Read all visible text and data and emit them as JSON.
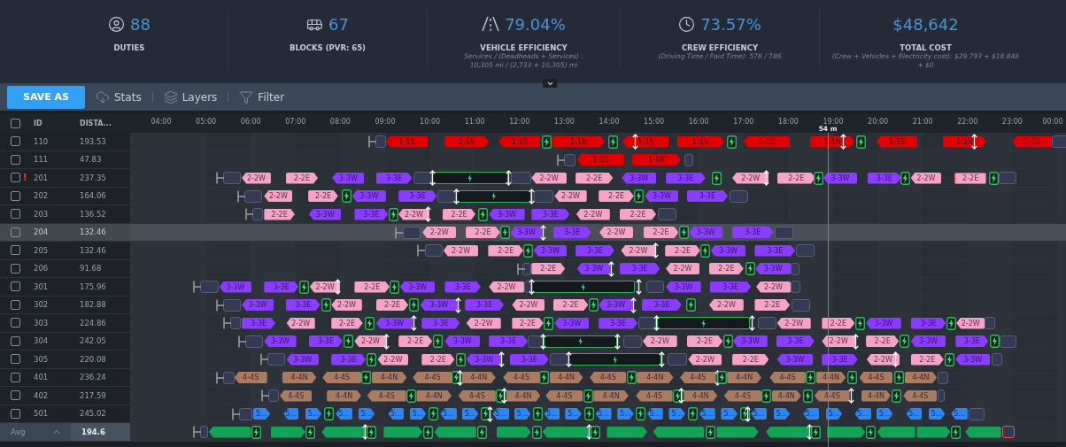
{
  "stats": [
    {
      "kind": "duties",
      "value": "88",
      "label": "DUTIES"
    },
    {
      "kind": "blocks",
      "value": "67",
      "label": "BLOCKS (PVR: 65)"
    },
    {
      "kind": "vehicle",
      "value": "79.04%",
      "label": "VEHICLE EFFICIENCY",
      "note": [
        "Services / (Deadheads + Services) :",
        "10,305 mi / (2,733 + 10,305) mi"
      ]
    },
    {
      "kind": "crew",
      "value": "73.57%",
      "label": "CREW EFFICIENCY",
      "note": [
        "(Driving Time / Paid Time): 578 / 786"
      ]
    },
    {
      "kind": "cost",
      "value": "$48,642",
      "label": "TOTAL COST",
      "note": [
        "(Crew + Vehicles + Electricity cost): $29.793 + $18.848",
        "+ $0"
      ]
    }
  ],
  "details_toggle": {
    "expanded": true
  },
  "toolbar": {
    "save_button": "SAVE AS",
    "tools": [
      {
        "kind": "stats",
        "label": "Stats"
      },
      {
        "kind": "layers",
        "label": "Layers"
      },
      {
        "kind": "filter",
        "label": "Filter"
      }
    ]
  },
  "columns": {
    "all_checked": false,
    "id": "ID",
    "distance": "DISTA..."
  },
  "hours": [
    "04:00",
    "05:00",
    "06:00",
    "07:00",
    "08:00",
    "09:00",
    "10:00",
    "11:00",
    "12:00",
    "13:00",
    "14:00",
    "15:00",
    "16:00",
    "17:00",
    "18:00",
    "19:00",
    "20:00",
    "21:00",
    "22:00",
    "23:00",
    "00:00"
  ],
  "cursor": {
    "label": "54 m"
  },
  "rows": [
    {
      "id": "110",
      "distance": "193.53",
      "checked": false,
      "selected": false,
      "items": [
        {
          "kind": "pullout"
        },
        {
          "kind": "depot"
        },
        {
          "kind": "trip",
          "label": "1-1S",
          "points_left": true,
          "color": "#e00000"
        },
        {
          "kind": "trip",
          "label": "1-1N",
          "points_left": false,
          "color": "#e00000"
        },
        {
          "kind": "trip",
          "label": "1-1S",
          "points_left": true,
          "color": "#e00000"
        },
        {
          "kind": "charge"
        },
        {
          "kind": "trip",
          "label": "1-1N",
          "points_left": false,
          "color": "#e00000"
        },
        {
          "kind": "charge"
        },
        {
          "kind": "trip",
          "label": "1-1S",
          "points_left": true,
          "color": "#e00000"
        },
        {
          "kind": "relief"
        },
        {
          "kind": "trip",
          "label": "1-1N",
          "points_left": false,
          "color": "#e00000"
        },
        {
          "kind": "charge"
        },
        {
          "kind": "trip",
          "label": "1-1S",
          "points_left": true,
          "color": "#e00000"
        },
        {
          "kind": "trip",
          "label": "1-1N",
          "points_left": false,
          "color": "#e00000"
        },
        {
          "kind": "relief"
        },
        {
          "kind": "charge"
        },
        {
          "kind": "trip",
          "label": "1-1S",
          "points_left": true,
          "color": "#e00000"
        },
        {
          "kind": "trip",
          "label": "1-1N",
          "points_left": false,
          "color": "#e00000"
        },
        {
          "kind": "relief"
        },
        {
          "kind": "trip",
          "label": "1-1S",
          "points_left": true,
          "color": "#e00000"
        },
        {
          "kind": "depot"
        }
      ]
    },
    {
      "id": "111",
      "distance": "47.83",
      "checked": false,
      "selected": false,
      "items": [
        {
          "kind": "pullout"
        },
        {
          "kind": "depot"
        },
        {
          "kind": "trip",
          "label": "1-1S",
          "points_left": true,
          "color": "#e00000"
        },
        {
          "kind": "trip",
          "label": "1-1N",
          "points_left": false,
          "color": "#e00000"
        },
        {
          "kind": "depot"
        }
      ]
    },
    {
      "id": "201",
      "distance": "237.35",
      "checked": false,
      "selected": false,
      "warning_mark": "!",
      "items": [
        {
          "kind": "pullout"
        },
        {
          "kind": "depot"
        },
        {
          "kind": "trip",
          "label": "2-2W",
          "points_left": true,
          "color": "#f5a3c7"
        },
        {
          "kind": "trip",
          "label": "2-2E",
          "points_left": false,
          "color": "#f5a3c7"
        },
        {
          "kind": "trip",
          "label": "3-3W",
          "points_left": true,
          "color": "#8b3dff"
        },
        {
          "kind": "trip",
          "label": "3-3E",
          "points_left": false,
          "color": "#8b3dff"
        },
        {
          "kind": "depot"
        },
        {
          "kind": "charging"
        },
        {
          "kind": "relief"
        },
        {
          "kind": "relief"
        },
        {
          "kind": "depot"
        },
        {
          "kind": "trip",
          "label": "2-2W",
          "points_left": true,
          "color": "#f5a3c7"
        },
        {
          "kind": "trip",
          "label": "2-2E",
          "points_left": false,
          "color": "#f5a3c7"
        },
        {
          "kind": "trip",
          "label": "3-3W",
          "points_left": true,
          "color": "#8b3dff"
        },
        {
          "kind": "trip",
          "label": "3-3E",
          "points_left": false,
          "color": "#8b3dff"
        },
        {
          "kind": "charge"
        },
        {
          "kind": "trip",
          "label": "2-2W",
          "points_left": true,
          "color": "#f5a3c7"
        },
        {
          "kind": "relief"
        },
        {
          "kind": "trip",
          "label": "2-2E",
          "points_left": false,
          "color": "#f5a3c7"
        },
        {
          "kind": "charge"
        },
        {
          "kind": "trip",
          "label": "3-3W",
          "points_left": true,
          "color": "#8b3dff"
        },
        {
          "kind": "trip",
          "label": "3-3E",
          "points_left": false,
          "color": "#8b3dff"
        },
        {
          "kind": "charge"
        },
        {
          "kind": "trip",
          "label": "2-2W",
          "points_left": true,
          "color": "#f5a3c7"
        },
        {
          "kind": "trip",
          "label": "2-2E",
          "points_left": false,
          "color": "#f5a3c7",
          "alert": true
        },
        {
          "kind": "charge"
        },
        {
          "kind": "depot"
        }
      ]
    },
    {
      "id": "202",
      "distance": "164.06",
      "checked": false,
      "selected": false,
      "items": [
        {
          "kind": "pullout"
        },
        {
          "kind": "depot"
        },
        {
          "kind": "trip",
          "label": "2-2W",
          "points_left": true,
          "color": "#f5a3c7"
        },
        {
          "kind": "trip",
          "label": "2-2E",
          "points_left": false,
          "color": "#f5a3c7"
        },
        {
          "kind": "charge"
        },
        {
          "kind": "trip",
          "label": "3-3W",
          "points_left": true,
          "color": "#8b3dff"
        },
        {
          "kind": "trip",
          "label": "3-3E",
          "points_left": false,
          "color": "#8b3dff"
        },
        {
          "kind": "depot"
        },
        {
          "kind": "charging"
        },
        {
          "kind": "relief"
        },
        {
          "kind": "relief"
        },
        {
          "kind": "depot"
        },
        {
          "kind": "trip",
          "label": "2-2W",
          "points_left": true,
          "color": "#f5a3c7"
        },
        {
          "kind": "trip",
          "label": "2-2E",
          "points_left": false,
          "color": "#f5a3c7"
        },
        {
          "kind": "charge"
        },
        {
          "kind": "trip",
          "label": "3-3W",
          "points_left": true,
          "color": "#8b3dff"
        },
        {
          "kind": "trip",
          "label": "3-3E",
          "points_left": false,
          "color": "#8b3dff"
        },
        {
          "kind": "depot"
        }
      ]
    },
    {
      "id": "203",
      "distance": "136.52",
      "checked": false,
      "selected": false,
      "items": [
        {
          "kind": "pullout"
        },
        {
          "kind": "depot"
        },
        {
          "kind": "trip",
          "label": "2-2E",
          "points_left": false,
          "color": "#f5a3c7"
        },
        {
          "kind": "trip",
          "label": "3-3W",
          "points_left": true,
          "color": "#8b3dff"
        },
        {
          "kind": "trip",
          "label": "3-3E",
          "points_left": false,
          "color": "#8b3dff"
        },
        {
          "kind": "charge"
        },
        {
          "kind": "trip",
          "label": "2-2W",
          "points_left": true,
          "color": "#f5a3c7"
        },
        {
          "kind": "relief"
        },
        {
          "kind": "trip",
          "label": "2-2E",
          "points_left": false,
          "color": "#f5a3c7"
        },
        {
          "kind": "charge"
        },
        {
          "kind": "trip",
          "label": "3-3W",
          "points_left": true,
          "color": "#8b3dff"
        },
        {
          "kind": "trip",
          "label": "3-3E",
          "points_left": false,
          "color": "#8b3dff"
        },
        {
          "kind": "trip",
          "label": "2-2W",
          "points_left": true,
          "color": "#f5a3c7"
        },
        {
          "kind": "trip",
          "label": "2-2E",
          "points_left": false,
          "color": "#f5a3c7"
        },
        {
          "kind": "depot"
        }
      ]
    },
    {
      "id": "204",
      "distance": "132.46",
      "checked": false,
      "selected": true,
      "items": [
        {
          "kind": "pullout"
        },
        {
          "kind": "depot"
        },
        {
          "kind": "trip",
          "label": "2-2W",
          "points_left": true,
          "color": "#f5a3c7"
        },
        {
          "kind": "trip",
          "label": "2-2E",
          "points_left": false,
          "color": "#f5a3c7"
        },
        {
          "kind": "charge"
        },
        {
          "kind": "trip",
          "label": "3-3W",
          "points_left": true,
          "color": "#8b3dff"
        },
        {
          "kind": "relief"
        },
        {
          "kind": "trip",
          "label": "3-3E",
          "points_left": false,
          "color": "#8b3dff"
        },
        {
          "kind": "trip",
          "label": "2-2W",
          "points_left": true,
          "color": "#f5a3c7"
        },
        {
          "kind": "trip",
          "label": "2-2E",
          "points_left": false,
          "color": "#f5a3c7"
        },
        {
          "kind": "charge"
        },
        {
          "kind": "trip",
          "label": "3-3W",
          "points_left": true,
          "color": "#8b3dff"
        },
        {
          "kind": "trip",
          "label": "3-3E",
          "points_left": false,
          "color": "#8b3dff"
        },
        {
          "kind": "depot"
        }
      ]
    },
    {
      "id": "205",
      "distance": "132.46",
      "checked": false,
      "selected": false,
      "items": [
        {
          "kind": "pullout"
        },
        {
          "kind": "depot"
        },
        {
          "kind": "trip",
          "label": "2-2W",
          "points_left": true,
          "color": "#f5a3c7"
        },
        {
          "kind": "trip",
          "label": "2-2E",
          "points_left": false,
          "color": "#f5a3c7"
        },
        {
          "kind": "charge"
        },
        {
          "kind": "trip",
          "label": "3-3W",
          "points_left": true,
          "color": "#8b3dff"
        },
        {
          "kind": "trip",
          "label": "3-3E",
          "points_left": false,
          "color": "#8b3dff"
        },
        {
          "kind": "trip",
          "label": "2-2W",
          "points_left": true,
          "color": "#f5a3c7"
        },
        {
          "kind": "relief"
        },
        {
          "kind": "trip",
          "label": "2-2E",
          "points_left": false,
          "color": "#f5a3c7"
        },
        {
          "kind": "charge"
        },
        {
          "kind": "trip",
          "label": "3-3W",
          "points_left": true,
          "color": "#8b3dff"
        },
        {
          "kind": "trip",
          "label": "3-3E",
          "points_left": false,
          "color": "#8b3dff"
        },
        {
          "kind": "depot"
        }
      ]
    },
    {
      "id": "206",
      "distance": "91.68",
      "checked": false,
      "selected": false,
      "items": [
        {
          "kind": "pullout"
        },
        {
          "kind": "depot"
        },
        {
          "kind": "trip",
          "label": "2-2E",
          "points_left": false,
          "color": "#f5a3c7"
        },
        {
          "kind": "trip",
          "label": "3-3W",
          "points_left": true,
          "color": "#8b3dff"
        },
        {
          "kind": "relief"
        },
        {
          "kind": "trip",
          "label": "3-3E",
          "points_left": false,
          "color": "#8b3dff"
        },
        {
          "kind": "trip",
          "label": "2-2W",
          "points_left": true,
          "color": "#f5a3c7"
        },
        {
          "kind": "trip",
          "label": "2-2E",
          "points_left": false,
          "color": "#f5a3c7"
        },
        {
          "kind": "charge"
        },
        {
          "kind": "trip",
          "label": "3-3W",
          "points_left": true,
          "color": "#8b3dff"
        },
        {
          "kind": "depot"
        }
      ]
    },
    {
      "id": "301",
      "distance": "175.96",
      "checked": false,
      "selected": false,
      "items": [
        {
          "kind": "pullout"
        },
        {
          "kind": "depot"
        },
        {
          "kind": "trip",
          "label": "3-3W",
          "points_left": true,
          "color": "#8b3dff"
        },
        {
          "kind": "trip",
          "label": "3-3E",
          "points_left": false,
          "color": "#8b3dff"
        },
        {
          "kind": "charge"
        },
        {
          "kind": "trip",
          "label": "2-2W",
          "points_left": true,
          "color": "#f5a3c7"
        },
        {
          "kind": "relief"
        },
        {
          "kind": "trip",
          "label": "2-2E",
          "points_left": false,
          "color": "#f5a3c7"
        },
        {
          "kind": "charge"
        },
        {
          "kind": "trip",
          "label": "3-3W",
          "points_left": true,
          "color": "#8b3dff"
        },
        {
          "kind": "trip",
          "label": "3-3E",
          "points_left": false,
          "color": "#8b3dff"
        },
        {
          "kind": "trip",
          "label": "2-2W",
          "points_left": true,
          "color": "#f5a3c7"
        },
        {
          "kind": "depot"
        },
        {
          "kind": "charging"
        },
        {
          "kind": "relief"
        },
        {
          "kind": "relief"
        },
        {
          "kind": "depot"
        },
        {
          "kind": "trip",
          "label": "3-3W",
          "points_left": true,
          "color": "#8b3dff"
        },
        {
          "kind": "trip",
          "label": "3-3E",
          "points_left": false,
          "color": "#8b3dff"
        },
        {
          "kind": "trip",
          "label": "2-2W",
          "points_left": true,
          "color": "#f5a3c7"
        },
        {
          "kind": "depot"
        }
      ]
    },
    {
      "id": "302",
      "distance": "182.88",
      "checked": false,
      "selected": false,
      "items": [
        {
          "kind": "pullout"
        },
        {
          "kind": "depot"
        },
        {
          "kind": "trip",
          "label": "3-3W",
          "points_left": true,
          "color": "#8b3dff"
        },
        {
          "kind": "trip",
          "label": "3-3E",
          "points_left": false,
          "color": "#8b3dff"
        },
        {
          "kind": "charge"
        },
        {
          "kind": "trip",
          "label": "2-2W",
          "points_left": true,
          "color": "#f5a3c7"
        },
        {
          "kind": "trip",
          "label": "2-2E",
          "points_left": false,
          "color": "#f5a3c7"
        },
        {
          "kind": "charge"
        },
        {
          "kind": "trip",
          "label": "3-3W",
          "points_left": true,
          "color": "#8b3dff"
        },
        {
          "kind": "relief"
        },
        {
          "kind": "trip",
          "label": "3-3E",
          "points_left": false,
          "color": "#8b3dff"
        },
        {
          "kind": "trip",
          "label": "2-2W",
          "points_left": true,
          "color": "#f5a3c7"
        },
        {
          "kind": "trip",
          "label": "2-2E",
          "points_left": false,
          "color": "#f5a3c7"
        },
        {
          "kind": "charge"
        },
        {
          "kind": "trip",
          "label": "3-3W",
          "points_left": true,
          "color": "#8b3dff"
        },
        {
          "kind": "relief"
        },
        {
          "kind": "trip",
          "label": "3-3E",
          "points_left": false,
          "color": "#8b3dff"
        },
        {
          "kind": "charge"
        },
        {
          "kind": "trip",
          "label": "2-2W",
          "points_left": true,
          "color": "#f5a3c7"
        },
        {
          "kind": "trip",
          "label": "2-2E",
          "points_left": false,
          "color": "#f5a3c7"
        },
        {
          "kind": "depot"
        }
      ]
    },
    {
      "id": "303",
      "distance": "224.86",
      "checked": false,
      "selected": false,
      "items": [
        {
          "kind": "pullout"
        },
        {
          "kind": "depot"
        },
        {
          "kind": "trip",
          "label": "3-3E",
          "points_left": false,
          "color": "#8b3dff"
        },
        {
          "kind": "trip",
          "label": "2-2W",
          "points_left": true,
          "color": "#f5a3c7"
        },
        {
          "kind": "trip",
          "label": "2-2E",
          "points_left": false,
          "color": "#f5a3c7"
        },
        {
          "kind": "charge"
        },
        {
          "kind": "trip",
          "label": "3-3W",
          "points_left": true,
          "color": "#8b3dff"
        },
        {
          "kind": "relief"
        },
        {
          "kind": "trip",
          "label": "3-3E",
          "points_left": false,
          "color": "#8b3dff"
        },
        {
          "kind": "trip",
          "label": "2-2W",
          "points_left": true,
          "color": "#f5a3c7"
        },
        {
          "kind": "trip",
          "label": "2-2E",
          "points_left": false,
          "color": "#f5a3c7"
        },
        {
          "kind": "charge"
        },
        {
          "kind": "trip",
          "label": "3-3W",
          "points_left": true,
          "color": "#8b3dff"
        },
        {
          "kind": "trip",
          "label": "3-3E",
          "points_left": false,
          "color": "#8b3dff"
        },
        {
          "kind": "depot"
        },
        {
          "kind": "charging"
        },
        {
          "kind": "relief"
        },
        {
          "kind": "relief"
        },
        {
          "kind": "depot"
        },
        {
          "kind": "trip",
          "label": "2-2W",
          "points_left": true,
          "color": "#f5a3c7"
        },
        {
          "kind": "trip",
          "label": "2-2E",
          "points_left": false,
          "color": "#f5a3c7"
        },
        {
          "kind": "charge"
        },
        {
          "kind": "trip",
          "label": "3-3W",
          "points_left": true,
          "color": "#8b3dff"
        },
        {
          "kind": "trip",
          "label": "3-3E",
          "points_left": false,
          "color": "#8b3dff"
        },
        {
          "kind": "charge"
        },
        {
          "kind": "trip",
          "label": "2-2W",
          "points_left": true,
          "color": "#f5a3c7"
        },
        {
          "kind": "depot"
        }
      ]
    },
    {
      "id": "304",
      "distance": "242.05",
      "checked": false,
      "selected": false,
      "items": [
        {
          "kind": "pullout"
        },
        {
          "kind": "depot"
        },
        {
          "kind": "trip",
          "label": "3-3W",
          "points_left": true,
          "color": "#8b3dff"
        },
        {
          "kind": "trip",
          "label": "3-3E",
          "points_left": false,
          "color": "#8b3dff"
        },
        {
          "kind": "charge"
        },
        {
          "kind": "trip",
          "label": "2-2W",
          "points_left": true,
          "color": "#f5a3c7"
        },
        {
          "kind": "relief"
        },
        {
          "kind": "trip",
          "label": "2-2E",
          "points_left": false,
          "color": "#f5a3c7"
        },
        {
          "kind": "charge"
        },
        {
          "kind": "trip",
          "label": "3-3W",
          "points_left": true,
          "color": "#8b3dff"
        },
        {
          "kind": "trip",
          "label": "3-3E",
          "points_left": false,
          "color": "#8b3dff"
        },
        {
          "kind": "depot"
        },
        {
          "kind": "charging"
        },
        {
          "kind": "relief"
        },
        {
          "kind": "relief"
        },
        {
          "kind": "depot"
        },
        {
          "kind": "trip",
          "label": "2-2W",
          "points_left": true,
          "color": "#f5a3c7"
        },
        {
          "kind": "trip",
          "label": "2-2E",
          "points_left": false,
          "color": "#f5a3c7"
        },
        {
          "kind": "charge"
        },
        {
          "kind": "trip",
          "label": "3-3W",
          "points_left": true,
          "color": "#8b3dff"
        },
        {
          "kind": "trip",
          "label": "3-3E",
          "points_left": false,
          "color": "#8b3dff"
        },
        {
          "kind": "trip",
          "label": "2-2W",
          "points_left": true,
          "color": "#f5a3c7"
        },
        {
          "kind": "relief"
        },
        {
          "kind": "trip",
          "label": "2-2E",
          "points_left": false,
          "color": "#f5a3c7"
        },
        {
          "kind": "charge"
        },
        {
          "kind": "trip",
          "label": "3-3W",
          "points_left": true,
          "color": "#8b3dff"
        },
        {
          "kind": "trip",
          "label": "3-3E",
          "points_left": false,
          "color": "#8b3dff"
        },
        {
          "kind": "charge"
        },
        {
          "kind": "depot"
        }
      ]
    },
    {
      "id": "305",
      "distance": "220.08",
      "checked": false,
      "selected": false,
      "items": [
        {
          "kind": "pullout"
        },
        {
          "kind": "depot"
        },
        {
          "kind": "trip",
          "label": "3-3W",
          "points_left": true,
          "color": "#8b3dff"
        },
        {
          "kind": "trip",
          "label": "3-3E",
          "points_left": false,
          "color": "#8b3dff"
        },
        {
          "kind": "charge"
        },
        {
          "kind": "trip",
          "label": "2-2W",
          "points_left": true,
          "color": "#f5a3c7"
        },
        {
          "kind": "trip",
          "label": "2-2E",
          "points_left": false,
          "color": "#f5a3c7"
        },
        {
          "kind": "charge"
        },
        {
          "kind": "trip",
          "label": "3-3W",
          "points_left": true,
          "color": "#8b3dff"
        },
        {
          "kind": "relief"
        },
        {
          "kind": "trip",
          "label": "3-3E",
          "points_left": false,
          "color": "#8b3dff"
        },
        {
          "kind": "depot"
        },
        {
          "kind": "charging"
        },
        {
          "kind": "relief"
        },
        {
          "kind": "relief"
        },
        {
          "kind": "depot"
        },
        {
          "kind": "trip",
          "label": "2-2W",
          "points_left": true,
          "color": "#f5a3c7"
        },
        {
          "kind": "trip",
          "label": "2-2E",
          "points_left": false,
          "color": "#f5a3c7"
        },
        {
          "kind": "trip",
          "label": "3-3W",
          "points_left": true,
          "color": "#8b3dff"
        },
        {
          "kind": "trip",
          "label": "3-3E",
          "points_left": false,
          "color": "#8b3dff"
        },
        {
          "kind": "trip",
          "label": "2-2W",
          "points_left": true,
          "color": "#f5a3c7"
        },
        {
          "kind": "relief"
        },
        {
          "kind": "trip",
          "label": "2-2E",
          "points_left": false,
          "color": "#f5a3c7"
        },
        {
          "kind": "charge"
        },
        {
          "kind": "trip",
          "label": "3-3W",
          "points_left": true,
          "color": "#8b3dff"
        },
        {
          "kind": "depot"
        }
      ]
    },
    {
      "id": "401",
      "distance": "236.24",
      "checked": false,
      "selected": false,
      "items": [
        {
          "kind": "pullout"
        },
        {
          "kind": "depot"
        },
        {
          "kind": "trip",
          "label": "4-4S",
          "points_left": true,
          "color": "#a97b62"
        },
        {
          "kind": "trip",
          "label": "4-4N",
          "points_left": false,
          "color": "#a97b62"
        },
        {
          "kind": "trip",
          "label": "4-4S",
          "points_left": true,
          "color": "#a97b62"
        },
        {
          "kind": "charge"
        },
        {
          "kind": "trip",
          "label": "4-4N",
          "points_left": false,
          "color": "#a97b62"
        },
        {
          "kind": "trip",
          "label": "4-4S",
          "points_left": true,
          "color": "#a97b62"
        },
        {
          "kind": "charge"
        },
        {
          "kind": "relief"
        },
        {
          "kind": "trip",
          "label": "4-4N",
          "points_left": false,
          "color": "#a97b62"
        },
        {
          "kind": "trip",
          "label": "4-4S",
          "points_left": true,
          "color": "#a97b62"
        },
        {
          "kind": "charge"
        },
        {
          "kind": "trip",
          "label": "4-4N",
          "points_left": false,
          "color": "#a97b62"
        },
        {
          "kind": "trip",
          "label": "4-4S",
          "points_left": true,
          "color": "#a97b62"
        },
        {
          "kind": "charge"
        },
        {
          "kind": "trip",
          "label": "4-4N",
          "points_left": false,
          "color": "#a97b62"
        },
        {
          "kind": "trip",
          "label": "4-4S",
          "points_left": true,
          "color": "#a97b62"
        },
        {
          "kind": "relief"
        },
        {
          "kind": "charge"
        },
        {
          "kind": "trip",
          "label": "4-4N",
          "points_left": false,
          "color": "#a97b62"
        },
        {
          "kind": "trip",
          "label": "4-4S",
          "points_left": true,
          "color": "#a97b62"
        },
        {
          "kind": "charge"
        },
        {
          "kind": "trip",
          "label": "4-4N",
          "points_left": false,
          "color": "#a97b62"
        },
        {
          "kind": "charge"
        },
        {
          "kind": "trip",
          "label": "4-4S",
          "points_left": true,
          "color": "#a97b62"
        },
        {
          "kind": "charge"
        },
        {
          "kind": "trip",
          "label": "4-4N",
          "points_left": false,
          "color": "#a97b62"
        },
        {
          "kind": "depot"
        }
      ]
    },
    {
      "id": "402",
      "distance": "217.59",
      "checked": false,
      "selected": false,
      "items": [
        {
          "kind": "pullout"
        },
        {
          "kind": "depot"
        },
        {
          "kind": "trip",
          "label": "4-4S",
          "points_left": true,
          "color": "#a97b62"
        },
        {
          "kind": "trip",
          "label": "4-4N",
          "points_left": false,
          "color": "#a97b62"
        },
        {
          "kind": "trip",
          "label": "4-4S",
          "points_left": true,
          "color": "#a97b62"
        },
        {
          "kind": "charge"
        },
        {
          "kind": "trip",
          "label": "4-4N",
          "points_left": false,
          "color": "#a97b62"
        },
        {
          "kind": "trip",
          "label": "4-4S",
          "points_left": true,
          "color": "#a97b62"
        },
        {
          "kind": "charge"
        },
        {
          "kind": "relief"
        },
        {
          "kind": "trip",
          "label": "4-4N",
          "points_left": false,
          "color": "#a97b62"
        },
        {
          "kind": "trip",
          "label": "4-4S",
          "points_left": true,
          "color": "#a97b62"
        },
        {
          "kind": "charge"
        },
        {
          "kind": "trip",
          "label": "4-4N",
          "points_left": false,
          "color": "#a97b62"
        },
        {
          "kind": "trip",
          "label": "4-4S",
          "points_left": true,
          "color": "#a97b62"
        },
        {
          "kind": "charge"
        },
        {
          "kind": "relief"
        },
        {
          "kind": "trip",
          "label": "4-4N",
          "points_left": false,
          "color": "#a97b62"
        },
        {
          "kind": "trip",
          "label": "4-4S",
          "points_left": true,
          "color": "#a97b62"
        },
        {
          "kind": "charge"
        },
        {
          "kind": "trip",
          "label": "4-4N",
          "points_left": false,
          "color": "#a97b62"
        },
        {
          "kind": "charge"
        },
        {
          "kind": "trip",
          "label": "4-4S",
          "points_left": true,
          "color": "#a97b62"
        },
        {
          "kind": "relief"
        },
        {
          "kind": "trip",
          "label": "4-4N",
          "points_left": false,
          "color": "#a97b62"
        },
        {
          "kind": "charge"
        },
        {
          "kind": "trip",
          "label": "4-4S",
          "points_left": true,
          "color": "#a97b62"
        },
        {
          "kind": "depot"
        }
      ]
    },
    {
      "id": "501",
      "distance": "245.02",
      "checked": false,
      "selected": false,
      "items": [
        {
          "kind": "pullout"
        },
        {
          "kind": "depot"
        },
        {
          "kind": "trip",
          "label": "5...",
          "points_left": false,
          "color": "#2f86f0"
        },
        {
          "kind": "trip",
          "label": "5...",
          "points_left": true,
          "color": "#2f86f0"
        },
        {
          "kind": "trip",
          "label": "5...",
          "points_left": false,
          "color": "#2f86f0"
        },
        {
          "kind": "charge"
        },
        {
          "kind": "trip",
          "label": "5...",
          "points_left": true,
          "color": "#2f86f0"
        },
        {
          "kind": "trip",
          "label": "5...",
          "points_left": false,
          "color": "#2f86f0"
        },
        {
          "kind": "trip",
          "label": "5...",
          "points_left": true,
          "color": "#2f86f0"
        },
        {
          "kind": "trip",
          "label": "5...",
          "points_left": false,
          "color": "#2f86f0"
        },
        {
          "kind": "charge"
        },
        {
          "kind": "trip",
          "label": "5...",
          "points_left": true,
          "color": "#2f86f0"
        },
        {
          "kind": "trip",
          "label": "5...",
          "points_left": false,
          "color": "#2f86f0"
        },
        {
          "kind": "charge"
        },
        {
          "kind": "relief"
        },
        {
          "kind": "trip",
          "label": "5...",
          "points_left": true,
          "color": "#2f86f0"
        },
        {
          "kind": "trip",
          "label": "5...",
          "points_left": false,
          "color": "#2f86f0"
        },
        {
          "kind": "charge"
        },
        {
          "kind": "trip",
          "label": "5...",
          "points_left": true,
          "color": "#2f86f0"
        },
        {
          "kind": "trip",
          "label": "5...",
          "points_left": false,
          "color": "#2f86f0"
        },
        {
          "kind": "charge"
        },
        {
          "kind": "trip",
          "label": "5...",
          "points_left": true,
          "color": "#2f86f0"
        },
        {
          "kind": "trip",
          "label": "5...",
          "points_left": false,
          "color": "#2f86f0"
        },
        {
          "kind": "charge"
        },
        {
          "kind": "trip",
          "label": "5...",
          "points_left": true,
          "color": "#2f86f0"
        },
        {
          "kind": "trip",
          "label": "5...",
          "points_left": false,
          "color": "#2f86f0"
        },
        {
          "kind": "charge"
        },
        {
          "kind": "trip",
          "label": "5...",
          "points_left": true,
          "color": "#2f86f0"
        },
        {
          "kind": "trip",
          "label": "5...",
          "points_left": false,
          "color": "#2f86f0"
        },
        {
          "kind": "charge"
        },
        {
          "kind": "relief"
        },
        {
          "kind": "trip",
          "label": "5...",
          "points_left": true,
          "color": "#2f86f0"
        },
        {
          "kind": "trip",
          "label": "5...",
          "points_left": false,
          "color": "#2f86f0"
        },
        {
          "kind": "trip",
          "label": "5...",
          "points_left": true,
          "color": "#2f86f0"
        },
        {
          "kind": "trip",
          "label": "5...",
          "points_left": false,
          "color": "#2f86f0"
        },
        {
          "kind": "trip",
          "label": "5...",
          "points_left": true,
          "color": "#2f86f0"
        },
        {
          "kind": "trip",
          "label": "5...",
          "points_left": false,
          "color": "#2f86f0"
        },
        {
          "kind": "trip",
          "label": "5...",
          "points_left": true,
          "color": "#2f86f0"
        },
        {
          "kind": "trip",
          "label": "5...",
          "points_left": false,
          "color": "#2f86f0"
        },
        {
          "kind": "trip",
          "label": "5...",
          "points_left": true,
          "color": "#2f86f0"
        },
        {
          "kind": "depot"
        }
      ]
    },
    {
      "selected": false,
      "items": [
        {
          "kind": "pullout"
        },
        {
          "kind": "depot"
        },
        {
          "kind": "trip",
          "points_left": true,
          "color": "#14a356"
        },
        {
          "kind": "charge"
        },
        {
          "kind": "trip",
          "points_left": false,
          "color": "#14a356"
        },
        {
          "kind": "charge"
        },
        {
          "kind": "trip",
          "points_left": true,
          "color": "#14a356"
        },
        {
          "kind": "relief"
        },
        {
          "kind": "charge"
        },
        {
          "kind": "trip",
          "points_left": false,
          "color": "#14a356"
        },
        {
          "kind": "charge"
        },
        {
          "kind": "trip",
          "points_left": true,
          "color": "#14a356"
        },
        {
          "kind": "charge"
        },
        {
          "kind": "trip",
          "points_left": false,
          "color": "#14a356"
        },
        {
          "kind": "charge"
        },
        {
          "kind": "trip",
          "points_left": true,
          "color": "#14a356"
        },
        {
          "kind": "relief"
        },
        {
          "kind": "charge"
        },
        {
          "kind": "trip",
          "points_left": false,
          "color": "#14a356"
        },
        {
          "kind": "trip",
          "points_left": true,
          "color": "#14a356"
        },
        {
          "kind": "charge"
        },
        {
          "kind": "trip",
          "points_left": false,
          "color": "#14a356"
        },
        {
          "kind": "trip",
          "points_left": true,
          "color": "#14a356"
        },
        {
          "kind": "relief"
        },
        {
          "kind": "charge"
        },
        {
          "kind": "trip",
          "points_left": false,
          "color": "#14a356"
        },
        {
          "kind": "charge"
        },
        {
          "kind": "trip",
          "points_left": true,
          "color": "#14a356"
        },
        {
          "kind": "trip",
          "points_left": false,
          "color": "#14a356"
        },
        {
          "kind": "charge"
        },
        {
          "kind": "trip",
          "points_left": true,
          "color": "#14a356"
        },
        {
          "kind": "depot",
          "alert": true
        }
      ]
    }
  ],
  "footer": {
    "label": "Avg",
    "expanded": false,
    "value": "194.6"
  }
}
